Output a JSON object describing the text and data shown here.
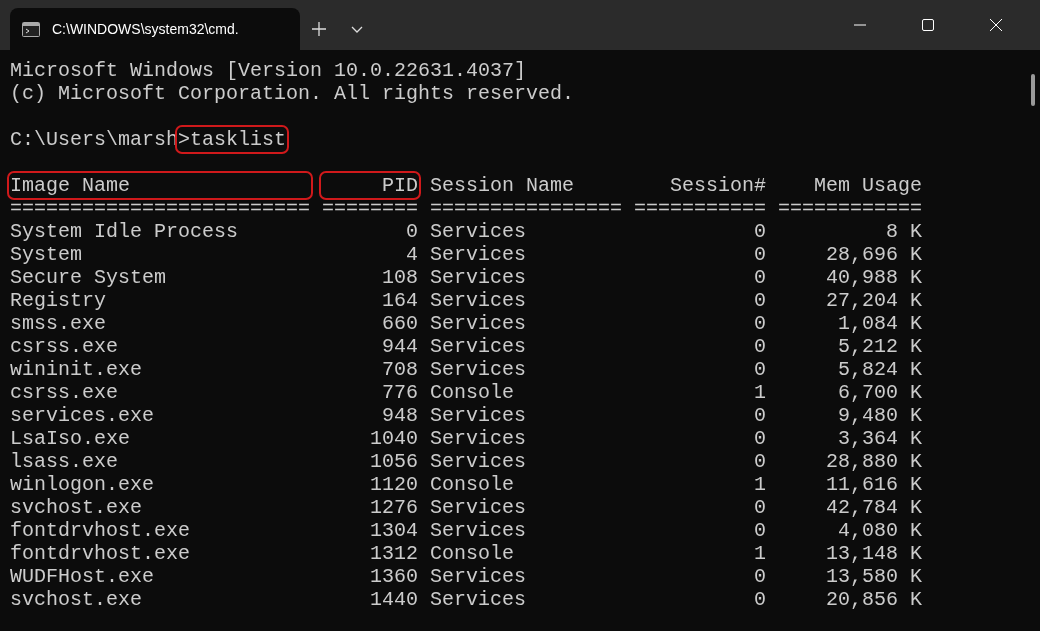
{
  "window": {
    "title": "C:\\WINDOWS\\system32\\cmd."
  },
  "intro": [
    "Microsoft Windows [Version 10.0.22631.4037]",
    "(c) Microsoft Corporation. All rights reserved."
  ],
  "prompt": {
    "path": "C:\\Users\\marsh",
    "command": ">tasklist",
    "highlighted": true
  },
  "table": {
    "columns": [
      {
        "heading": "Image Name",
        "rule": "=========================",
        "highlighted": true
      },
      {
        "heading": "PID",
        "rule": "========",
        "highlighted": true
      },
      {
        "heading": "Session Name",
        "rule": "================",
        "highlighted": false
      },
      {
        "heading": "Session#",
        "rule": "===========",
        "highlighted": false
      },
      {
        "heading": "Mem Usage",
        "rule": "============",
        "highlighted": false
      }
    ],
    "rows": [
      [
        "System Idle Process",
        "0",
        "Services",
        "0",
        "8 K"
      ],
      [
        "System",
        "4",
        "Services",
        "0",
        "28,696 K"
      ],
      [
        "Secure System",
        "108",
        "Services",
        "0",
        "40,988 K"
      ],
      [
        "Registry",
        "164",
        "Services",
        "0",
        "27,204 K"
      ],
      [
        "smss.exe",
        "660",
        "Services",
        "0",
        "1,084 K"
      ],
      [
        "csrss.exe",
        "944",
        "Services",
        "0",
        "5,212 K"
      ],
      [
        "wininit.exe",
        "708",
        "Services",
        "0",
        "5,824 K"
      ],
      [
        "csrss.exe",
        "776",
        "Console",
        "1",
        "6,700 K"
      ],
      [
        "services.exe",
        "948",
        "Services",
        "0",
        "9,480 K"
      ],
      [
        "LsaIso.exe",
        "1040",
        "Services",
        "0",
        "3,364 K"
      ],
      [
        "lsass.exe",
        "1056",
        "Services",
        "0",
        "28,880 K"
      ],
      [
        "winlogon.exe",
        "1120",
        "Console",
        "1",
        "11,616 K"
      ],
      [
        "svchost.exe",
        "1276",
        "Services",
        "0",
        "42,784 K"
      ],
      [
        "fontdrvhost.exe",
        "1304",
        "Services",
        "0",
        "4,080 K"
      ],
      [
        "fontdrvhost.exe",
        "1312",
        "Console",
        "1",
        "13,148 K"
      ],
      [
        "WUDFHost.exe",
        "1360",
        "Services",
        "0",
        "13,580 K"
      ],
      [
        "svchost.exe",
        "1440",
        "Services",
        "0",
        "20,856 K"
      ]
    ]
  }
}
